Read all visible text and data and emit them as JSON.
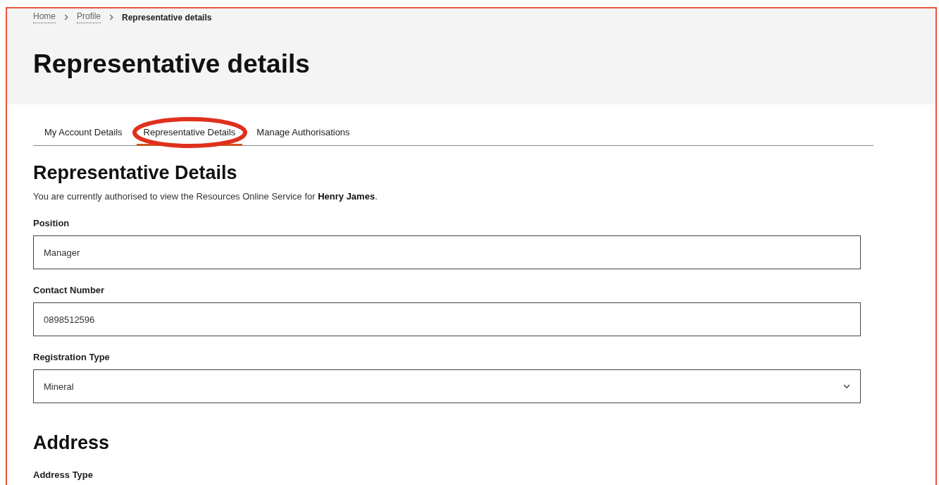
{
  "breadcrumb": [
    {
      "label": "Home",
      "kind": "link"
    },
    {
      "label": "Profile",
      "kind": "link"
    },
    {
      "label": "Representative details",
      "kind": "current"
    }
  ],
  "page_title": "Representative details",
  "tabs": [
    {
      "label": "My Account Details",
      "selected": false
    },
    {
      "label": "Representative Details",
      "selected": true
    },
    {
      "label": "Manage Authorisations",
      "selected": false
    }
  ],
  "annotation": {
    "kind": "ellipse",
    "color": "#e0301e"
  },
  "section_title": "Representative Details",
  "intro": "You are currently authorised to view the Resources Online Service for **Henry James**.",
  "fields": [
    {
      "label": "Position",
      "kind": "text",
      "value": "Manager"
    },
    {
      "label": "Contact Number",
      "kind": "text",
      "value": "0898512596"
    },
    {
      "label": "Registration Type",
      "kind": "select",
      "value": "Mineral"
    }
  ],
  "address": {
    "title": "Address",
    "fields": [
      {
        "label": "Address Type"
      }
    ]
  }
}
